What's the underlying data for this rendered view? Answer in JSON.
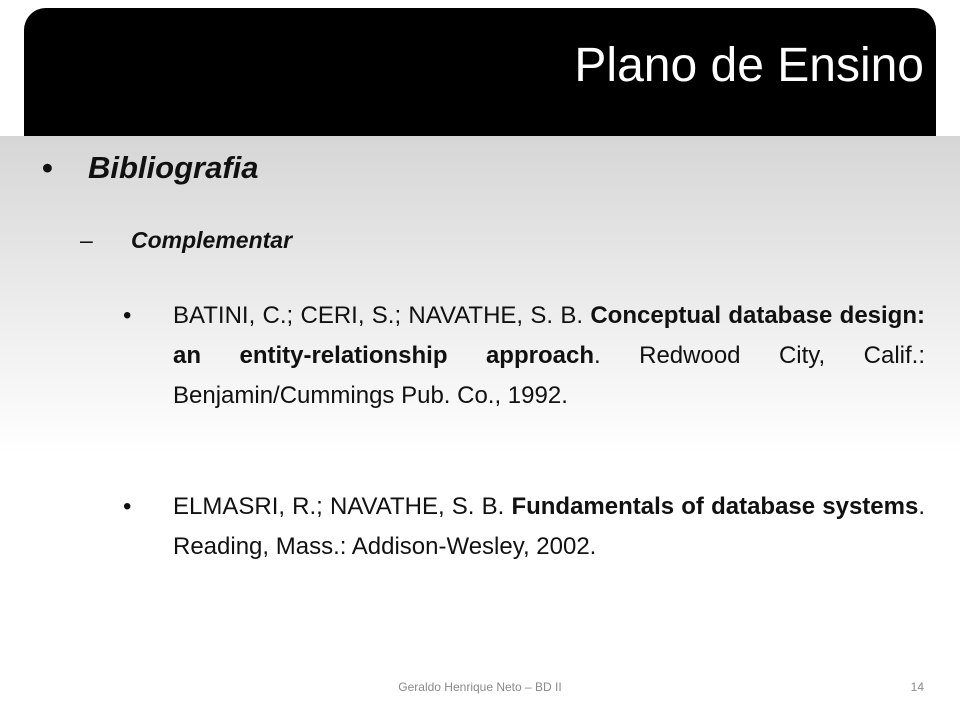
{
  "slide": {
    "title": "Plano de Ensino",
    "bullet_char": "•",
    "dash_char": "–",
    "heading": "Bibliografia",
    "subheading": "Complementar",
    "references": [
      {
        "authors": "BATINI, C.; CERI, S.; NAVATHE, S. B. ",
        "title": "Conceptual database design: an entity-relationship approach",
        "rest": ". Redwood City, Calif.: Benjamin/Cummings Pub. Co., 1992."
      },
      {
        "authors": "ELMASRI, R.; NAVATHE, S. B. ",
        "title": "Fundamentals of database systems",
        "rest": ". Reading, Mass.: Addison-Wesley, 2002."
      }
    ],
    "footer": "Geraldo Henrique Neto – BD II",
    "page_number": "14"
  }
}
